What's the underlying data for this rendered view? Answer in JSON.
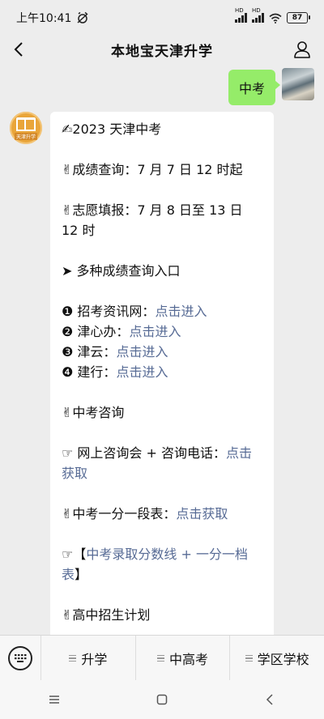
{
  "status_bar": {
    "time": "上午10:41",
    "signal_label_1": "HD",
    "signal_label_2": "HD",
    "battery": "87"
  },
  "header": {
    "title": "本地宝天津升学"
  },
  "sent_message": {
    "text": "中考"
  },
  "received_avatar": {
    "brand_text": "天津升学"
  },
  "received_message": {
    "title": "✍2023 天津中考",
    "score_query": "✌成绩查询：7 月 7 日 12 时起",
    "application_line1": "✌志愿填报：7 月 8 日至 13 日",
    "application_line2": "12 时",
    "entries_heading": "➤ 多种成绩查询入口",
    "entries": [
      {
        "prefix": "❶ 招考资讯网：",
        "link": "点击进入"
      },
      {
        "prefix": "❷ 津心办：",
        "link": "点击进入"
      },
      {
        "prefix": "❸ 津云：",
        "link": "点击进入"
      },
      {
        "prefix": "❹ 建行：",
        "link": "点击进入"
      }
    ],
    "consult_heading": "✌中考咨询",
    "consult_prefix": "☞ 网上咨询会 + 咨询电话：",
    "consult_link_1": "点击",
    "consult_link_2": "获取",
    "score_table_prefix": "✌中考一分一段表：",
    "score_table_link": "点击获取",
    "cutoff_prefix": "☞【",
    "cutoff_link_1": "中考录取分数线 + 一分一档",
    "cutoff_link_2": "表",
    "cutoff_suffix": "】",
    "plan_heading": "✌高中招生计划"
  },
  "bottom_menu": {
    "items": [
      "升学",
      "中高考",
      "学区学校"
    ]
  },
  "colors": {
    "background": "#ededed",
    "sent_bubble": "#95ec69",
    "link": "#576b95",
    "avatar_orange": "#e9a53a"
  }
}
